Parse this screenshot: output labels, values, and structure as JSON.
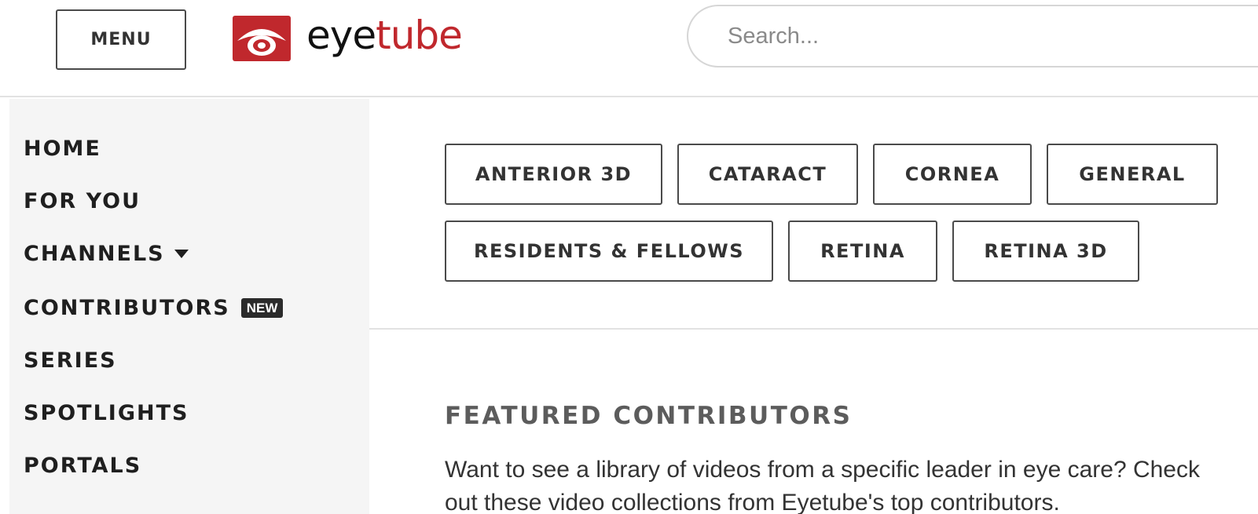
{
  "header": {
    "menu_label": "MENU",
    "logo": {
      "eye": "ey",
      "e": "e",
      "tube": "tube",
      "brand_red": "#c0282d"
    },
    "search": {
      "placeholder": "Search...",
      "value": ""
    }
  },
  "sidebar": {
    "items": [
      {
        "label": "HOME"
      },
      {
        "label": "FOR YOU"
      },
      {
        "label": "CHANNELS",
        "icon": "caret-down-icon"
      },
      {
        "label": "CONTRIBUTORS",
        "badge": "NEW"
      },
      {
        "label": "SERIES"
      },
      {
        "label": "SPOTLIGHTS"
      },
      {
        "label": "PORTALS"
      }
    ]
  },
  "channels": {
    "buttons": [
      {
        "label": "ANTERIOR 3D"
      },
      {
        "label": "CATARACT"
      },
      {
        "label": "CORNEA"
      },
      {
        "label": "GENERAL"
      },
      {
        "label": "RESIDENTS & FELLOWS"
      },
      {
        "label": "RETINA"
      },
      {
        "label": "RETINA 3D"
      }
    ]
  },
  "featured": {
    "title": "FEATURED CONTRIBUTORS",
    "description": "Want to see a library of videos from a specific leader in eye care? Check out these video collections from Eyetube's top contributors."
  }
}
